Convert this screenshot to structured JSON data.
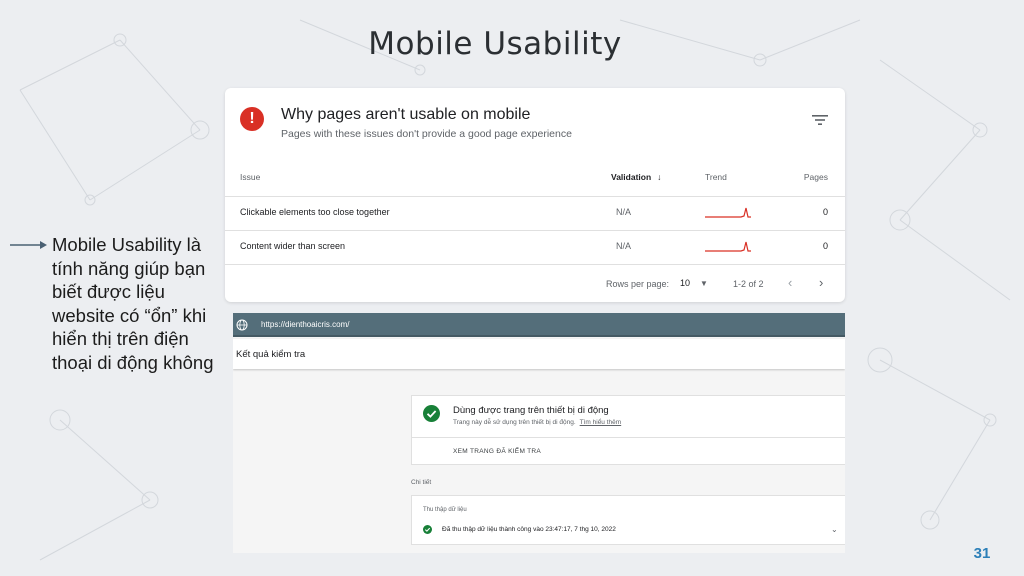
{
  "slide": {
    "title": "Mobile Usability",
    "side_text": "Mobile Usability là tính năng giúp bạn biết được liệu website có “ổn” khi hiển thị trên điện thoại di động không",
    "page_number": "31",
    "page_number_color": "#2c7fb8"
  },
  "issues_card": {
    "title": "Why pages aren't usable on mobile",
    "subtitle": "Pages with these issues don't provide a good page experience",
    "icons": {
      "status": "error-icon",
      "filter": "filter-icon"
    },
    "error_color": "#d93025",
    "columns": {
      "issue": "Issue",
      "validation": "Validation",
      "trend": "Trend",
      "pages": "Pages"
    },
    "rows": [
      {
        "issue": "Clickable elements too close together",
        "validation": "N/A",
        "pages": "0"
      },
      {
        "issue": "Content wider than screen",
        "validation": "N/A",
        "pages": "0"
      }
    ],
    "pagination": {
      "rows_per_page_label": "Rows per page:",
      "rows_per_page": "10",
      "range": "1-2 of 2"
    }
  },
  "mobile_test": {
    "url": "https://dienthoaicris.com/",
    "results_title": "Kết quả kiểm tra",
    "usable": {
      "title": "Dùng được trang trên thiết bị di động",
      "subtitle": "Trang này dễ sử dụng trên thiết bị di động.",
      "learn_more": "Tìm hiểu thêm",
      "view_button": "XEM TRANG ĐÃ KIỂM TRA"
    },
    "details_label": "Chi tiết",
    "crawl": {
      "label": "Thu thập dữ liệu",
      "status": "Đã thu thập dữ liệu thành công vào 23:47:17, 7 thg 10, 2022"
    },
    "success_color": "#188038"
  }
}
